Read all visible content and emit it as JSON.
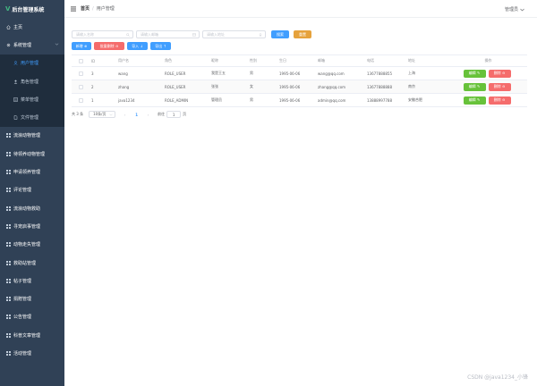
{
  "app": {
    "logo_letter": "V",
    "title": "后台管理系统"
  },
  "sidebar": {
    "items": [
      {
        "label": "主页",
        "type": "top",
        "icon": "home-icon"
      },
      {
        "label": "系统管理",
        "type": "top",
        "icon": "gear-icon",
        "expanded": true
      },
      {
        "label": "用户管理",
        "type": "sub",
        "icon": "user-icon",
        "active": true
      },
      {
        "label": "角色管理",
        "type": "sub",
        "icon": "role-icon"
      },
      {
        "label": "菜单管理",
        "type": "sub",
        "icon": "menu-icon"
      },
      {
        "label": "文件管理",
        "type": "sub",
        "icon": "file-icon"
      },
      {
        "label": "流浪动物管理",
        "type": "top",
        "icon": "grid-icon"
      },
      {
        "label": "待领养动物管理",
        "type": "top",
        "icon": "grid-icon"
      },
      {
        "label": "申请领养管理",
        "type": "top",
        "icon": "grid-icon"
      },
      {
        "label": "评论管理",
        "type": "top",
        "icon": "grid-icon"
      },
      {
        "label": "流浪动物救助",
        "type": "top",
        "icon": "grid-icon"
      },
      {
        "label": "寻宠启事管理",
        "type": "top",
        "icon": "grid-icon"
      },
      {
        "label": "动物走失管理",
        "type": "top",
        "icon": "grid-icon"
      },
      {
        "label": "救助站管理",
        "type": "top",
        "icon": "grid-icon"
      },
      {
        "label": "帖子管理",
        "type": "top",
        "icon": "grid-icon"
      },
      {
        "label": "捐赠管理",
        "type": "top",
        "icon": "grid-icon"
      },
      {
        "label": "公告管理",
        "type": "top",
        "icon": "grid-icon"
      },
      {
        "label": "科普文章管理",
        "type": "top",
        "icon": "grid-icon"
      },
      {
        "label": "活动管理",
        "type": "top",
        "icon": "grid-icon"
      }
    ]
  },
  "header": {
    "breadcrumb_home": "首页",
    "breadcrumb_sep": "/",
    "breadcrumb_current": "用户管理",
    "user_label": "管理员"
  },
  "search": {
    "name_placeholder": "请输入名称",
    "email_placeholder": "请输入邮箱",
    "address_placeholder": "请输入地址",
    "search_label": "搜索",
    "reset_label": "重置"
  },
  "actions": {
    "add_label": "新增 ⊕",
    "batch_delete_label": "批量删除 ⊖",
    "import_label": "导入 ↓",
    "export_label": "导出 ↑"
  },
  "table": {
    "columns": [
      "",
      "ID",
      "用户名",
      "角色",
      "昵称",
      "性别",
      "生日",
      "邮箱",
      "电话",
      "地址",
      "操作"
    ],
    "rows": [
      {
        "id": "3",
        "username": "wang",
        "role": "ROLE_USER",
        "nickname": "我是王五",
        "sex": "男",
        "birthday": "1995-06-06",
        "email": "wang@qq.com",
        "phone": "13677888855",
        "address": "上海"
      },
      {
        "id": "2",
        "username": "zhang",
        "role": "ROLE_USER",
        "nickname": "张张",
        "sex": "女",
        "birthday": "1995-06-06",
        "email": "zhang@qq.com",
        "phone": "13677888888",
        "address": "南京"
      },
      {
        "id": "1",
        "username": "java1234",
        "role": "ROLE_ADMIN",
        "nickname": "管理员",
        "sex": "男",
        "birthday": "1995-06-06",
        "email": "admin@qq.com",
        "phone": "13888997788",
        "address": "安徽合肥"
      }
    ],
    "edit_label": "编辑 ✎",
    "delete_label": "删除 ⊖"
  },
  "pagination": {
    "total": "共 3 条",
    "page_size": "10条/页",
    "prev": "‹",
    "current": "1",
    "next": "›",
    "goto_prefix": "前往",
    "goto_value": "1",
    "goto_suffix": "页"
  },
  "watermark": "CSDN @java1234_小锋",
  "colors": {
    "sidebar_bg": "#304156",
    "primary": "#409eff",
    "success": "#67c23a",
    "danger": "#f56c6c",
    "warning": "#e6a23c"
  }
}
